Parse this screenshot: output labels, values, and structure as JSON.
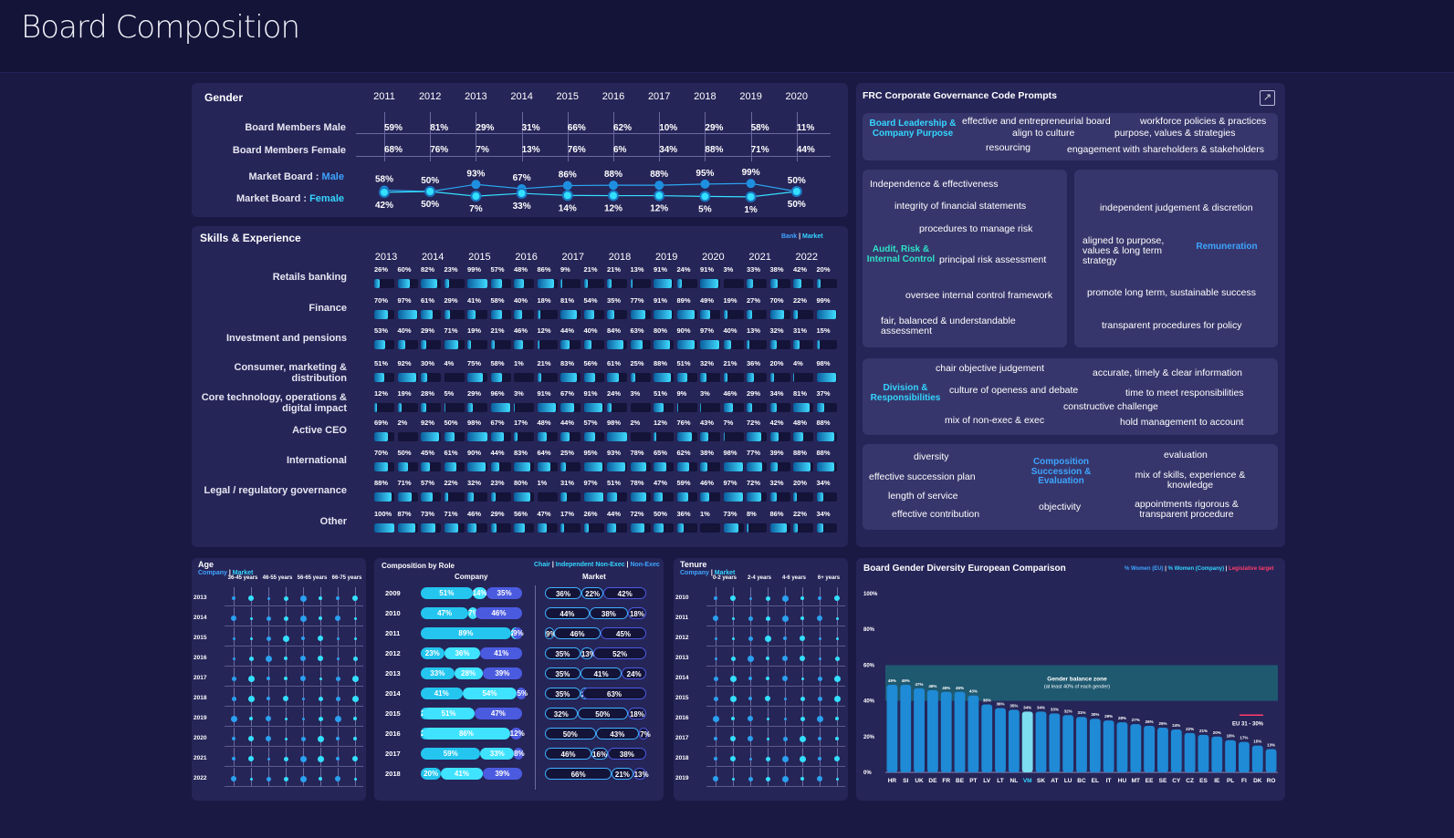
{
  "title": "Board Composition",
  "gender": {
    "title": "Gender",
    "years": [
      "2011",
      "2012",
      "2013",
      "2014",
      "2015",
      "2016",
      "2017",
      "2018",
      "2019",
      "2020"
    ],
    "row_labels": {
      "male": "Board Members Male",
      "female": "Board Members Female"
    },
    "board_male": [
      "59%",
      "81%",
      "29%",
      "31%",
      "66%",
      "62%",
      "10%",
      "29%",
      "58%",
      "11%"
    ],
    "board_female": [
      "68%",
      "76%",
      "7%",
      "13%",
      "76%",
      "6%",
      "34%",
      "88%",
      "71%",
      "44%"
    ],
    "market_label_prefix": "Market Board : ",
    "market_male_word": "Male",
    "market_female_word": "Female",
    "market_male": [
      58,
      50,
      93,
      67,
      86,
      88,
      88,
      95,
      99,
      50
    ],
    "market_female": [
      42,
      50,
      7,
      33,
      14,
      12,
      12,
      5,
      1,
      50
    ],
    "market_male_labels": [
      "58%",
      "50%",
      "93%",
      "67%",
      "86%",
      "88%",
      "88%",
      "95%",
      "99%",
      "50%"
    ],
    "market_female_labels": [
      "42%",
      "50%",
      "7%",
      "33%",
      "14%",
      "12%",
      "12%",
      "5%",
      "1%",
      "50%"
    ]
  },
  "skills": {
    "title": "Skills & Experience",
    "legend_bank": "Bank",
    "legend_sep": " | ",
    "legend_market": "Market",
    "years": [
      "2013",
      "2014",
      "2015",
      "2016",
      "2017",
      "2018",
      "2019",
      "2020",
      "2021",
      "2022"
    ],
    "rows": [
      {
        "label": "Retails banking",
        "values": [
          "26%",
          "60%",
          "82%",
          "23%",
          "99%",
          "57%",
          "48%",
          "86%",
          "9%",
          "21%",
          "21%",
          "13%",
          "91%",
          "24%",
          "91%",
          "3%",
          "33%",
          "38%",
          "42%",
          "20%"
        ]
      },
      {
        "label": "Finance",
        "values": [
          "70%",
          "97%",
          "61%",
          "29%",
          "41%",
          "58%",
          "40%",
          "18%",
          "81%",
          "54%",
          "35%",
          "77%",
          "91%",
          "89%",
          "49%",
          "19%",
          "27%",
          "70%",
          "22%",
          "99%"
        ]
      },
      {
        "label": "Investment and pensions",
        "values": [
          "53%",
          "40%",
          "29%",
          "71%",
          "19%",
          "21%",
          "46%",
          "12%",
          "44%",
          "40%",
          "84%",
          "63%",
          "80%",
          "90%",
          "97%",
          "40%",
          "13%",
          "32%",
          "31%",
          "15%"
        ]
      },
      {
        "label": "Consumer, marketing & distribution",
        "values": [
          "51%",
          "92%",
          "30%",
          "4%",
          "75%",
          "58%",
          "1%",
          "21%",
          "83%",
          "56%",
          "61%",
          "25%",
          "88%",
          "51%",
          "32%",
          "21%",
          "36%",
          "20%",
          "4%",
          "98%"
        ]
      },
      {
        "label": "Core technology, operations & digital impact",
        "values": [
          "12%",
          "19%",
          "28%",
          "5%",
          "29%",
          "96%",
          "3%",
          "91%",
          "67%",
          "91%",
          "24%",
          "3%",
          "51%",
          "9%",
          "3%",
          "46%",
          "29%",
          "34%",
          "81%",
          "37%"
        ]
      },
      {
        "label": "Active CEO",
        "values": [
          "69%",
          "2%",
          "92%",
          "50%",
          "98%",
          "67%",
          "17%",
          "48%",
          "44%",
          "57%",
          "98%",
          "2%",
          "12%",
          "76%",
          "43%",
          "7%",
          "72%",
          "42%",
          "48%",
          "88%"
        ]
      },
      {
        "label": "International",
        "values": [
          "70%",
          "50%",
          "45%",
          "61%",
          "90%",
          "44%",
          "83%",
          "64%",
          "25%",
          "95%",
          "93%",
          "78%",
          "65%",
          "62%",
          "38%",
          "98%",
          "77%",
          "39%",
          "88%",
          "88%"
        ]
      },
      {
        "label": "Legal / regulatory governance",
        "values": [
          "88%",
          "71%",
          "57%",
          "22%",
          "32%",
          "23%",
          "80%",
          "1%",
          "31%",
          "97%",
          "51%",
          "78%",
          "47%",
          "59%",
          "46%",
          "97%",
          "72%",
          "32%",
          "20%",
          "34%"
        ]
      },
      {
        "label": "Other",
        "values": [
          "100%",
          "87%",
          "73%",
          "71%",
          "46%",
          "29%",
          "56%",
          "47%",
          "17%",
          "26%",
          "44%",
          "72%",
          "50%",
          "36%",
          "1%",
          "73%",
          "8%",
          "86%",
          "22%",
          "34%"
        ]
      }
    ]
  },
  "frc": {
    "title": "FRC Corporate Governance Code Prompts",
    "leadership": {
      "category": "Board Leadership & Company Purpose",
      "items": [
        "effective and entrepreneurial board",
        "align to culture",
        "resourcing",
        "workforce policies & practices",
        "purpose, values & strategies",
        "engagement with shareholders & stakeholders"
      ]
    },
    "audit": {
      "category": "Audit, Risk & Internal Control",
      "items": [
        "Independence & effectiveness",
        "integrity of financial statements",
        "procedures to manage risk",
        "principal risk assessment",
        "oversee internal control framework",
        "fair, balanced & understandable assessment"
      ]
    },
    "remuneration": {
      "category": "Remuneration",
      "items": [
        "independent judgement & discretion",
        "aligned to purpose, values & long term strategy",
        "promote long term, sustainable success",
        "transparent procedures for policy"
      ]
    },
    "division": {
      "category": "Division & Responsibilities",
      "items": [
        "chair objective judgement",
        "culture of openess and debate",
        "mix of non-exec & exec",
        "accurate, timely & clear information",
        "time to meet responsibilities",
        "constructive challenge",
        "hold management to account"
      ]
    },
    "composition": {
      "category": "Composition Succession & Evaluation",
      "items": [
        "diversity",
        "effective succession plan",
        "length of service",
        "effective contribution",
        "objectivity",
        "evaluation",
        "mix of skills, experience & knowledge",
        "appointments rigorous & transparent procedure"
      ]
    }
  },
  "age": {
    "title": "Age",
    "legend_company": "Company",
    "legend_market": "Market",
    "groups": [
      "36-45 years",
      "46-55 years",
      "56-65 years",
      "66-75 years"
    ],
    "years": [
      "2013",
      "2014",
      "2015",
      "2016",
      "2017",
      "2018",
      "2019",
      "2020",
      "2021",
      "2022"
    ]
  },
  "role": {
    "title": "Composition by Role",
    "legend": [
      "Chair",
      "Independent Non-Exec",
      "Non-Exec"
    ],
    "company_label": "Company",
    "market_label": "Market",
    "years": [
      "2009",
      "2010",
      "2011",
      "2012",
      "2013",
      "2014",
      "2015",
      "2016",
      "2017",
      "2018"
    ],
    "company": [
      [
        51,
        14,
        35
      ],
      [
        47,
        7,
        46
      ],
      [
        89,
        2,
        9
      ],
      [
        23,
        36,
        41
      ],
      [
        33,
        28,
        39
      ],
      [
        41,
        54,
        5
      ],
      [
        2,
        51,
        47
      ],
      [
        2,
        86,
        12
      ],
      [
        59,
        33,
        8
      ],
      [
        20,
        41,
        39
      ]
    ],
    "market": [
      [
        36,
        22,
        42
      ],
      [
        44,
        38,
        18
      ],
      [
        9,
        46,
        45
      ],
      [
        35,
        13,
        52
      ],
      [
        35,
        41,
        24
      ],
      [
        35,
        2,
        63
      ],
      [
        32,
        50,
        18
      ],
      [
        50,
        43,
        7
      ],
      [
        46,
        16,
        38
      ],
      [
        66,
        21,
        13
      ]
    ]
  },
  "tenure": {
    "title": "Tenure",
    "legend_company": "Company",
    "legend_market": "Market",
    "groups": [
      "0-2 years",
      "2-4 years",
      "4-6 years",
      "6+ years"
    ],
    "years": [
      "2010",
      "2011",
      "2012",
      "2013",
      "2014",
      "2015",
      "2016",
      "2017",
      "2018",
      "2019"
    ]
  },
  "euro": {
    "title": "Board Gender Diversity European Comparison",
    "legend": [
      "% Women (EU)",
      "% Women (Company)",
      "Legislative target"
    ],
    "zone_title": "Gender balance zone",
    "zone_sub": "(at least 40% of each gender)",
    "target_label": "EU 31 - 30%",
    "y_ticks": [
      "100%",
      "80%",
      "60%",
      "40%",
      "20%",
      "0%"
    ],
    "chart_data": {
      "type": "bar",
      "categories": [
        "HR",
        "SI",
        "UK",
        "DE",
        "FR",
        "BE",
        "PT",
        "LV",
        "LT",
        "NL",
        "VM",
        "SK",
        "AT",
        "LU",
        "BC",
        "EL",
        "IT",
        "HU",
        "MT",
        "EE",
        "SE",
        "CY",
        "CZ",
        "ES",
        "IE",
        "PL",
        "FI",
        "DK",
        "RO"
      ],
      "values": [
        49,
        49,
        47,
        46,
        45,
        45,
        43,
        38,
        36,
        35,
        34,
        34,
        33,
        32,
        31,
        30,
        29,
        28,
        27,
        26,
        25,
        24,
        22,
        21,
        20,
        18,
        17,
        15,
        13
      ],
      "value_labels": [
        "49%",
        "49%",
        "47%",
        "46%",
        "45%",
        "45%",
        "43%",
        "38%",
        "36%",
        "35%",
        "34%",
        "34%",
        "33%",
        "32%",
        "31%",
        "30%",
        "29%",
        "28%",
        "27%",
        "26%",
        "25%",
        "24%",
        "22%",
        "21%",
        "20%",
        "18%",
        "17%",
        "15%",
        "13%"
      ],
      "ylim": [
        0,
        100
      ]
    }
  }
}
